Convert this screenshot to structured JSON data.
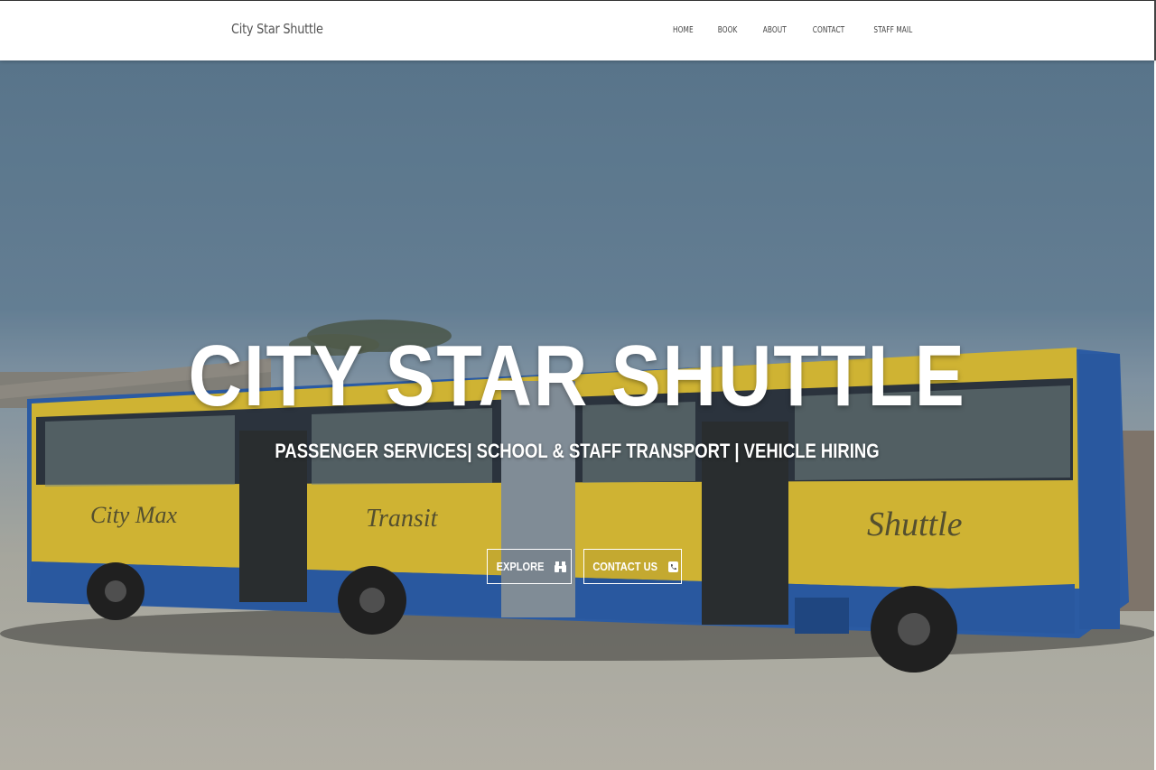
{
  "header": {
    "brand": "City Star Shuttle",
    "nav": [
      "HOME",
      "BOOK",
      "ABOUT",
      "CONTACT",
      "STAFF MAIL"
    ]
  },
  "hero": {
    "title": "CITY STAR SHUTTLE",
    "subtitle": "PASSENGER SERVICES| SCHOOL & STAFF TRANSPORT | VEHICLE HIRING",
    "buttons": {
      "explore": {
        "label": "EXPLORE",
        "icon": "binoculars-icon"
      },
      "contact": {
        "label": "CONTACT US",
        "icon": "phone-icon"
      }
    },
    "background_image": {
      "bus_text": [
        "City Max",
        "Transit",
        "Shuttle"
      ]
    }
  },
  "colors": {
    "bus_yellow": "#e8c832",
    "bus_blue": "#2a5fb0",
    "sky": "#6c8aa2",
    "ground": "#c5c2b6"
  }
}
